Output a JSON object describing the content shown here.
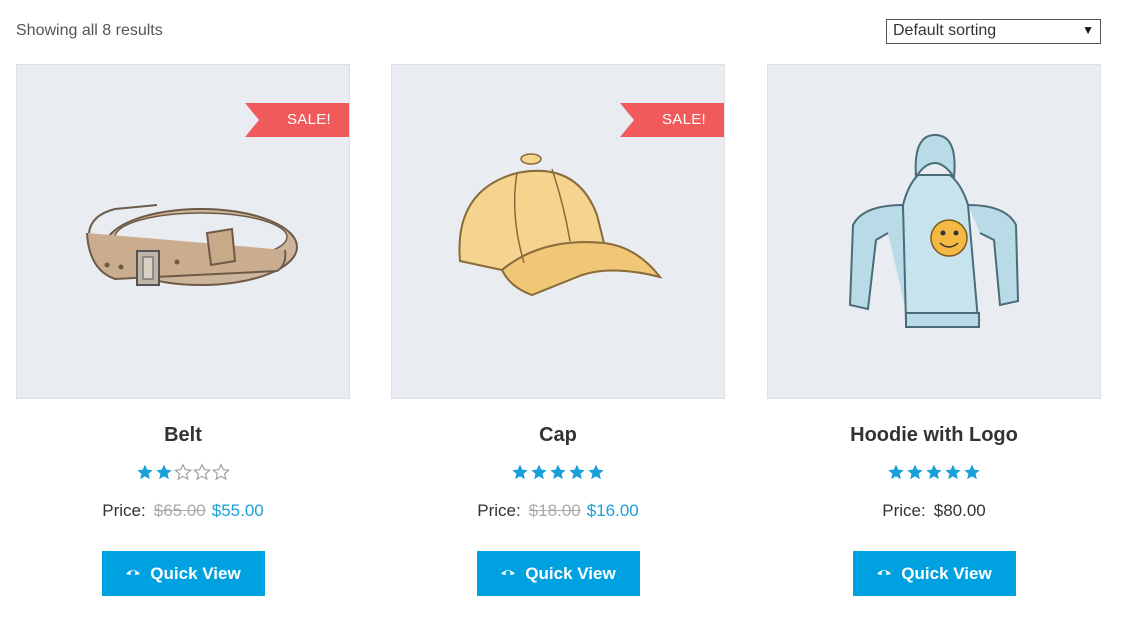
{
  "results_count": "Showing all 8 results",
  "sorting": {
    "selected": "Default sorting"
  },
  "colors": {
    "accent": "#00a1e0",
    "sale": "#f05a5a",
    "star": "#1a9fd8",
    "image_bg": "#e9edf1"
  },
  "products": [
    {
      "name": "Belt",
      "sale_badge": "SALE!",
      "rating": 2,
      "rating_max": 5,
      "price_label": "Price:",
      "old_price": "$65.00",
      "price": "$55.00",
      "button": "Quick View",
      "icon": "eye-icon"
    },
    {
      "name": "Cap",
      "sale_badge": "SALE!",
      "rating": 5,
      "rating_max": 5,
      "price_label": "Price:",
      "old_price": "$18.00",
      "price": "$16.00",
      "button": "Quick View",
      "icon": "eye-icon"
    },
    {
      "name": "Hoodie with Logo",
      "rating": 5,
      "rating_max": 5,
      "price_label": "Price:",
      "price": "$80.00",
      "button": "Quick View",
      "icon": "eye-icon"
    }
  ]
}
